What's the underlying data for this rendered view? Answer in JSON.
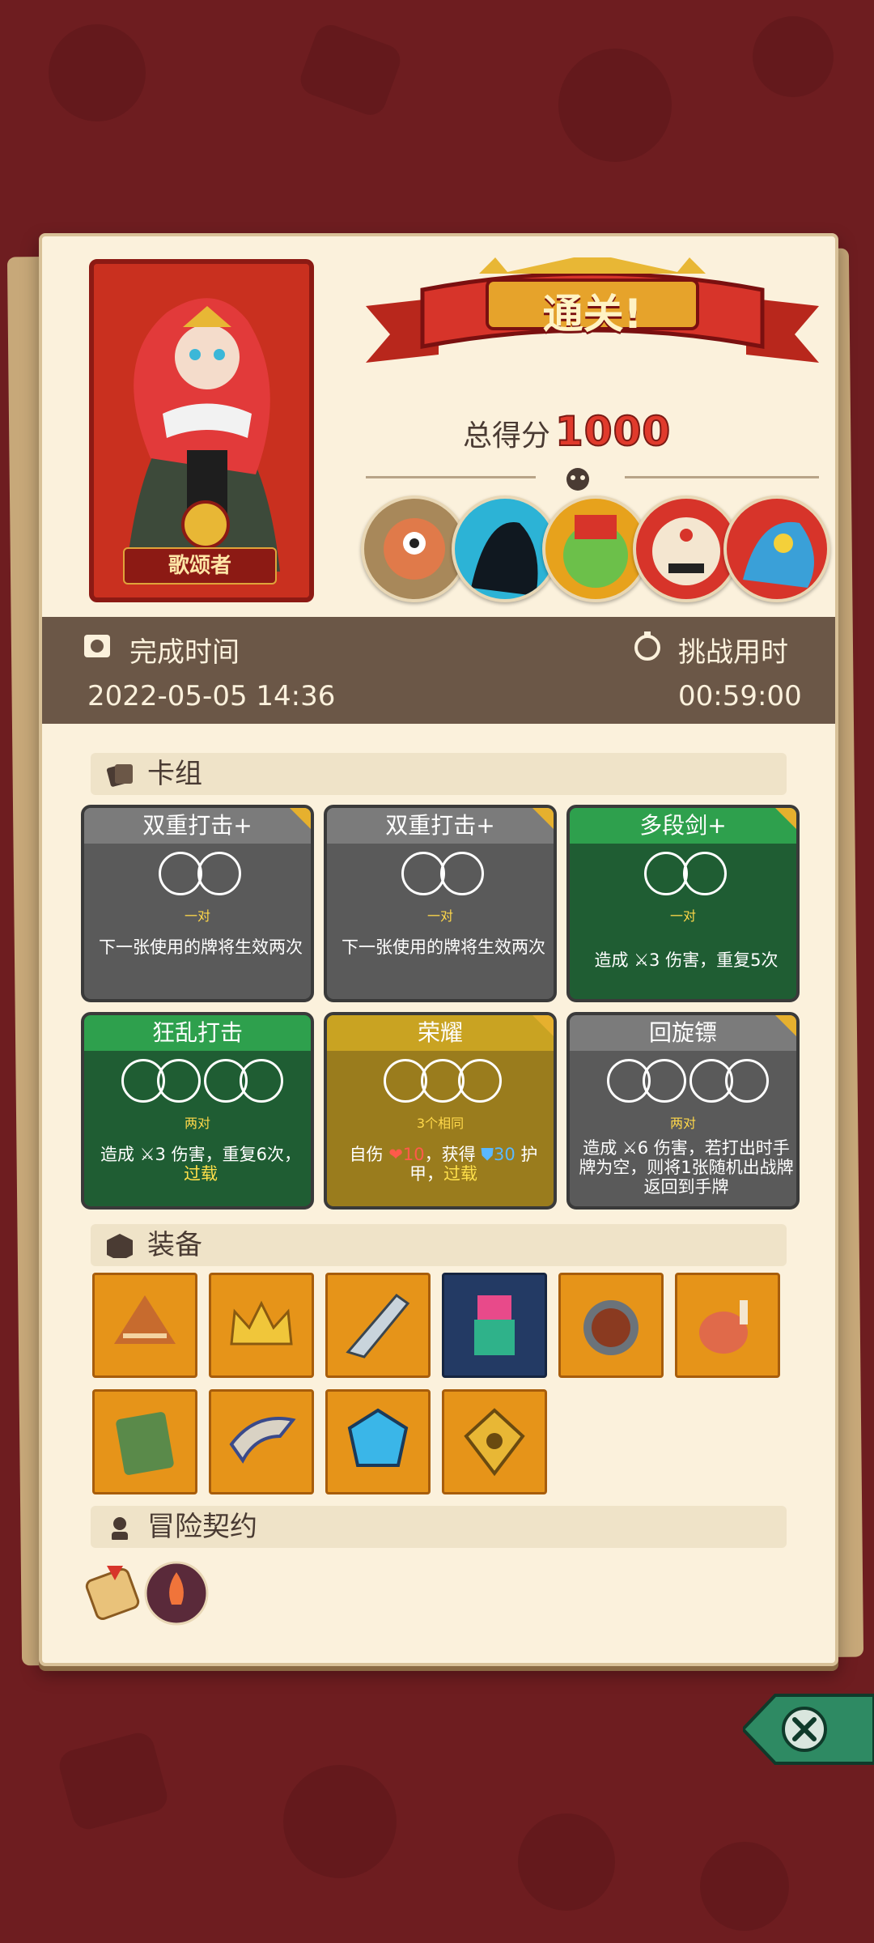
{
  "hero": {
    "name": "歌颂者"
  },
  "banner": {
    "title": "通关!"
  },
  "score": {
    "label": "总得分",
    "value": "1000"
  },
  "time": {
    "finish_label": "完成时间",
    "finish_value": "2022-05-05 14:36",
    "challenge_label": "挑战用时",
    "challenge_value": "00:59:00"
  },
  "sections": {
    "deck": "卡组",
    "equipment": "装备",
    "contract": "冒险契约"
  },
  "cards": [
    {
      "title": "双重打击+",
      "sub": "一对",
      "desc": "下一张使用的牌将生效两次"
    },
    {
      "title": "双重打击+",
      "sub": "一对",
      "desc": "下一张使用的牌将生效两次"
    },
    {
      "title": "多段剑+",
      "sub": "一对",
      "desc": "造成 ⚔3 伤害，重复5次"
    },
    {
      "title": "狂乱打击",
      "sub": "两对",
      "desc_a": "造成 ⚔3 伤害，重复6次，",
      "desc_b": "过载"
    },
    {
      "title": "荣耀",
      "sub": "3个相同",
      "desc_a": "自伤 ",
      "desc_r": "❤10",
      "desc_c": "，获得 ",
      "desc_bl": "⛊30",
      "desc_d": " 护甲，",
      "desc_e": "过载"
    },
    {
      "title": "回旋镖",
      "sub": "两对",
      "desc": "造成 ⚔6 伤害，若打出时手牌为空，则将1张随机出战牌返回到手牌"
    }
  ],
  "icons": [
    "camera-icon",
    "stopwatch-icon",
    "cards-icon",
    "cube-icon",
    "contract-icon",
    "close-icon"
  ],
  "colors": {
    "accent_red": "#e03a2c",
    "panel": "#fbf1dc",
    "timebar": "#6b5747"
  }
}
